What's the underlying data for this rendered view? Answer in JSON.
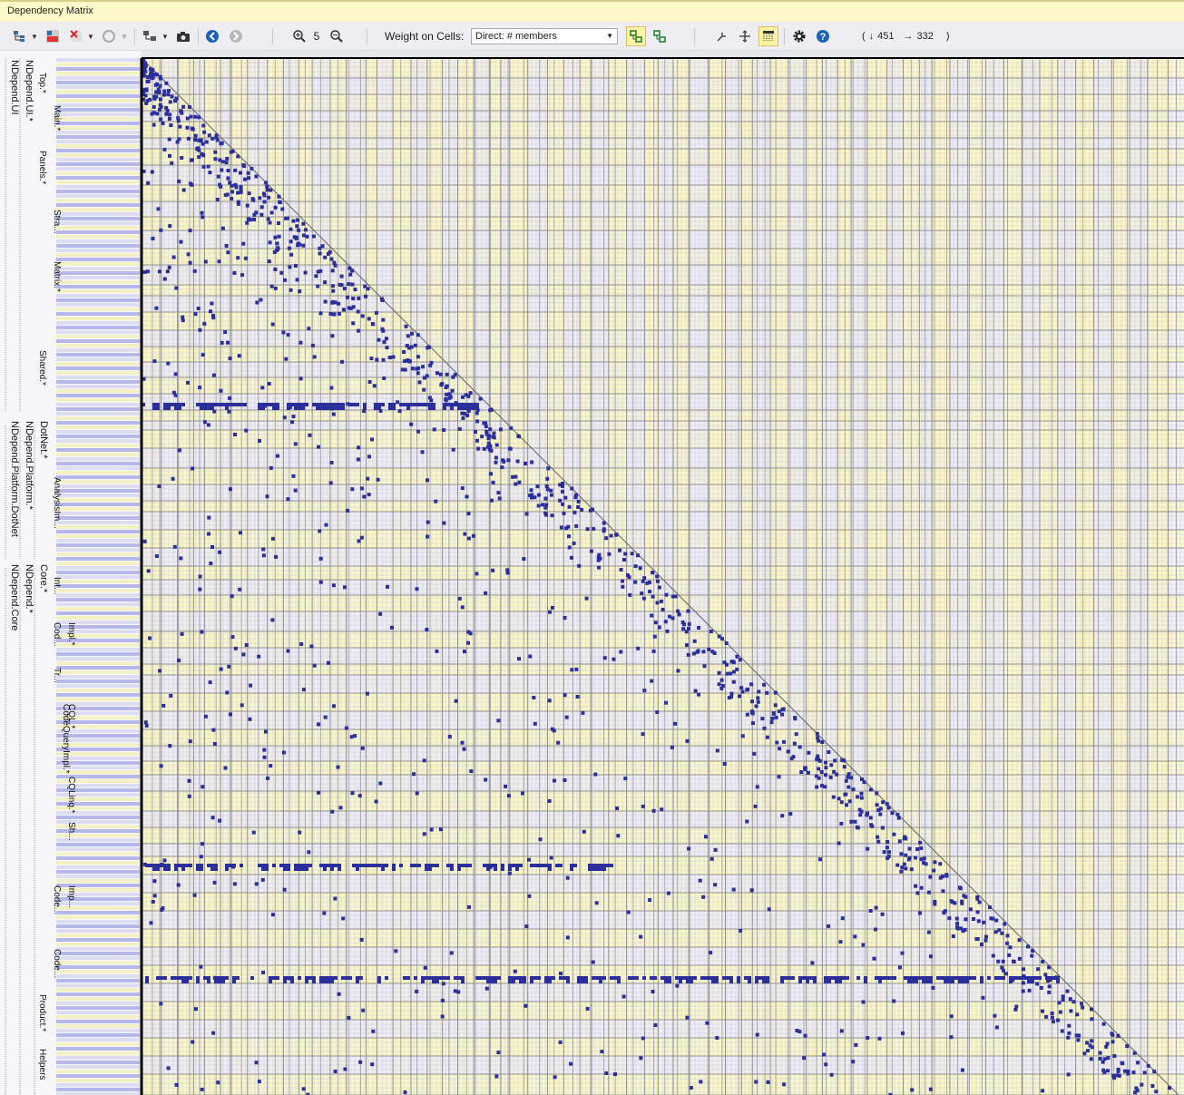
{
  "window": {
    "title": "Dependency Matrix"
  },
  "toolbar": {
    "zoom_level": "5",
    "weight_label": "Weight on Cells:",
    "weight_value": "Direct: # members",
    "coord_open": "(",
    "coord_rows_icon": "↓",
    "coord_rows": "451",
    "coord_cols_icon": "→",
    "coord_cols": "332",
    "coord_close": ")",
    "icons": [
      "tree-layout-icon",
      "delete-rows-icon",
      "remove-icon",
      "disabled-circle-icon",
      "filter-icon",
      "camera-icon",
      "back-icon",
      "forward-icon",
      "zoom-in-icon",
      "zoom-out-icon",
      "bind-cols-rows-icon",
      "cycle-icon",
      "arrows-in-icon",
      "arrows-out-icon",
      "view-toggle-icon",
      "gear-icon",
      "help-icon"
    ]
  },
  "tree": {
    "groups": [
      {
        "label": "NDepend.UI"
      },
      {
        "label": "NDepend.UI.*"
      },
      {
        "label": "NDepend.Platform.DotNet"
      },
      {
        "label": "NDepend.Platform.*"
      },
      {
        "label": "DotNet.*"
      },
      {
        "label": "NDepend.Core"
      },
      {
        "label": "NDepend.*"
      },
      {
        "label": "Core.*"
      }
    ],
    "subgroups": [
      "Top.*",
      "Main.*",
      "Panels.*",
      "Stra...",
      "Matrix.*",
      "Shared.*",
      "AnalysisIm...",
      "Int...",
      "Cod...",
      "Impl.*",
      "Tr...",
      "CodeQueryImpl.*",
      "CQL.*",
      "CQLinq.*",
      "Sh...",
      "Code...",
      "Imp...",
      "Code...",
      "Product.*",
      "Helpers"
    ]
  },
  "colors": {
    "band_yellow": "#fbf6b9",
    "band_lavender": "#e9e8f6",
    "grid_dark": "#8f8f8f",
    "grid_light": "#cfcfd6",
    "cell": "#2b2f9c",
    "tree_bg": "#f7f7fa",
    "tree_stripe": "#b6b8ec"
  }
}
